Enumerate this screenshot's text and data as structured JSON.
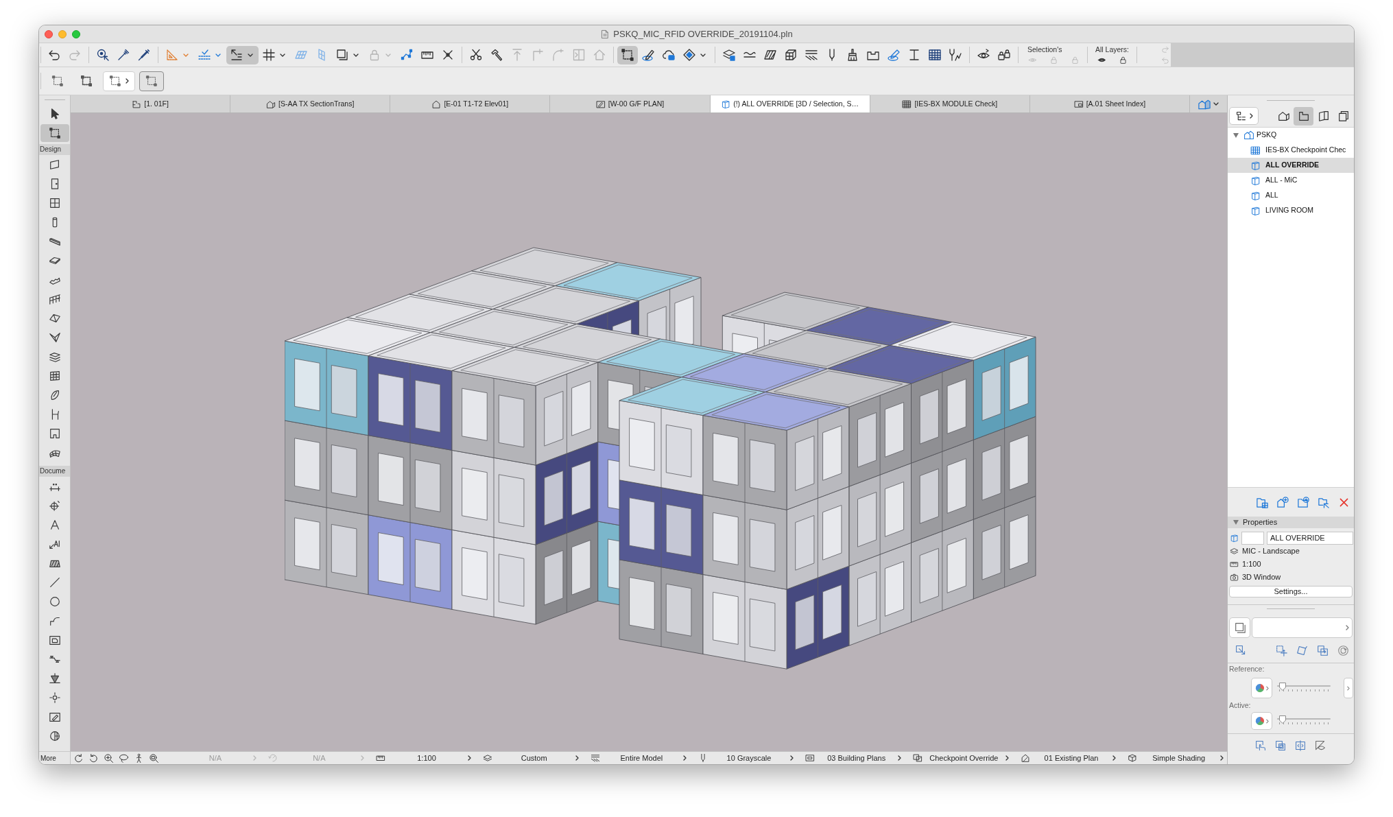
{
  "window": {
    "title": "PSKQ_MIC_RFID OVERRIDE_20191104.pln"
  },
  "toolbar": {
    "groups": [
      {
        "buttons": [
          {
            "pressed": false,
            "disabled": false
          },
          {
            "pressed": false,
            "disabled": true
          }
        ]
      },
      {
        "buttons": [
          {
            "pressed": false,
            "disabled": false
          },
          {
            "pressed": false,
            "disabled": false
          },
          {
            "pressed": false,
            "disabled": false
          }
        ]
      },
      {
        "buttons": [
          {
            "pressed": false,
            "disabled": false
          },
          {
            "pressed": false,
            "disabled": false
          },
          {
            "pressed": true,
            "disabled": false
          },
          {
            "pressed": false,
            "disabled": false
          },
          {
            "pressed": false,
            "disabled": false
          },
          {
            "pressed": false,
            "disabled": false
          },
          {
            "pressed": false,
            "disabled": false
          },
          {
            "pressed": false,
            "disabled": true
          },
          {
            "pressed": false,
            "disabled": false
          },
          {
            "pressed": false,
            "disabled": false
          },
          {
            "pressed": false,
            "disabled": false
          }
        ]
      },
      {
        "buttons": [
          {
            "pressed": false,
            "disabled": false
          },
          {
            "pressed": false,
            "disabled": false
          },
          {
            "pressed": false,
            "disabled": true
          },
          {
            "pressed": false,
            "disabled": true
          },
          {
            "pressed": false,
            "disabled": true
          },
          {
            "pressed": false,
            "disabled": true
          },
          {
            "pressed": false,
            "disabled": true
          }
        ]
      },
      {
        "buttons": [
          {
            "pressed": true,
            "disabled": false
          },
          {
            "pressed": false,
            "disabled": false
          },
          {
            "pressed": false,
            "disabled": false
          },
          {
            "pressed": false,
            "disabled": false
          }
        ]
      },
      {
        "buttons": [
          {
            "pressed": false,
            "disabled": false
          },
          {
            "pressed": false,
            "disabled": false
          },
          {
            "pressed": false,
            "disabled": false
          },
          {
            "pressed": false,
            "disabled": false
          },
          {
            "pressed": false,
            "disabled": false
          },
          {
            "pressed": false,
            "disabled": false
          },
          {
            "pressed": false,
            "disabled": false
          },
          {
            "pressed": false,
            "disabled": false
          },
          {
            "pressed": false,
            "disabled": false
          },
          {
            "pressed": false,
            "disabled": false
          },
          {
            "pressed": false,
            "disabled": false
          },
          {
            "pressed": false,
            "disabled": false
          }
        ]
      },
      {
        "buttons": [
          {
            "pressed": false,
            "disabled": false
          },
          {
            "pressed": false,
            "disabled": false
          }
        ]
      }
    ],
    "selection": {
      "label": "Selection's",
      "buttons": [
        {
          "disabled": true
        },
        {
          "disabled": true
        },
        {
          "disabled": true
        }
      ]
    },
    "layers": {
      "label": "All Layers:",
      "buttons": [
        {
          "disabled": false
        },
        {
          "disabled": false
        }
      ]
    },
    "history": {
      "buttons": [
        {
          "disabled": true
        },
        {
          "disabled": true
        }
      ]
    }
  },
  "marquee_options": [
    {
      "selected": false
    },
    {
      "selected": false
    },
    {
      "selected": false
    },
    {
      "selected": true
    }
  ],
  "tabs": [
    {
      "kind": "plan",
      "label": "[1. 01F]",
      "selected": false
    },
    {
      "kind": "section",
      "label": "[S-AA TX SectionTrans]",
      "selected": false
    },
    {
      "kind": "elevation",
      "label": "[E-01 T1-T2 Elev01]",
      "selected": false
    },
    {
      "kind": "worksheet",
      "label": "[W-00 G/F PLAN]",
      "selected": false
    },
    {
      "kind": "model",
      "label": "(!) ALL OVERRIDE [3D / Selection, S…",
      "selected": true
    },
    {
      "kind": "schedule",
      "label": "[IES-BX MODULE Check]",
      "selected": false
    },
    {
      "kind": "layout",
      "label": "[A.01 Sheet Index]",
      "selected": false
    }
  ],
  "toolbox": {
    "top_tools": [
      {
        "selected": false
      },
      {
        "selected": true
      }
    ],
    "sections": [
      {
        "label": "Design",
        "tools": [
          {
            "selected": false
          },
          {
            "selected": false
          },
          {
            "selected": false
          },
          {
            "selected": false
          },
          {
            "selected": false
          },
          {
            "selected": false
          },
          {
            "selected": false
          },
          {
            "selected": false
          },
          {
            "selected": false
          },
          {
            "selected": false
          },
          {
            "selected": false
          },
          {
            "selected": false
          },
          {
            "selected": false
          },
          {
            "selected": false
          },
          {
            "selected": false
          },
          {
            "selected": false
          }
        ]
      },
      {
        "label": "Docume",
        "tools": [
          {
            "selected": false
          },
          {
            "selected": false
          },
          {
            "selected": false
          },
          {
            "selected": false
          },
          {
            "selected": false
          },
          {
            "selected": false
          },
          {
            "selected": false
          },
          {
            "selected": false
          },
          {
            "selected": false
          },
          {
            "selected": false
          },
          {
            "selected": false
          },
          {
            "selected": false
          },
          {
            "selected": false
          },
          {
            "selected": false
          }
        ]
      }
    ],
    "more": "More"
  },
  "status_bar": {
    "items": [
      {
        "value": "N/A",
        "disabled": true
      },
      {
        "value": "N/A",
        "disabled": true
      },
      {
        "value": "1:100",
        "disabled": false
      },
      {
        "value": "Custom",
        "disabled": false
      },
      {
        "value": "Entire Model",
        "disabled": false
      },
      {
        "value": "10 Grayscale",
        "disabled": false
      },
      {
        "value": "03 Building Plans",
        "disabled": false
      },
      {
        "value": "Checkpoint Override",
        "disabled": false
      },
      {
        "value": "01 Existing Plan",
        "disabled": false
      },
      {
        "value": "Simple Shading",
        "disabled": false
      }
    ]
  },
  "navigator": {
    "views": [
      {
        "selected": false
      },
      {
        "selected": true
      },
      {
        "selected": false
      },
      {
        "selected": false
      }
    ],
    "tree": [
      {
        "kind": "project",
        "label": "PSKQ",
        "expanded": true,
        "selected": false,
        "children": [
          {
            "kind": "schedule",
            "label": "IES-BX Checkpoint Chec",
            "selected": false
          },
          {
            "kind": "view",
            "label": "ALL OVERRIDE",
            "selected": true
          },
          {
            "kind": "view",
            "label": "ALL - MiC",
            "selected": false
          },
          {
            "kind": "view",
            "label": "ALL",
            "selected": false
          },
          {
            "kind": "view",
            "label": "LIVING ROOM",
            "selected": false
          }
        ]
      }
    ]
  },
  "properties": {
    "title": "Properties",
    "expanded": true,
    "name": "ALL OVERRIDE",
    "layer_combination": "MIC - Landscape",
    "scale": "1:100",
    "window": "3D Window",
    "settings": "Settings..."
  },
  "quick_options": {
    "reference": {
      "label": "Reference:",
      "level": 0.05
    },
    "active": {
      "label": "Active:",
      "level": 0.05
    }
  }
}
